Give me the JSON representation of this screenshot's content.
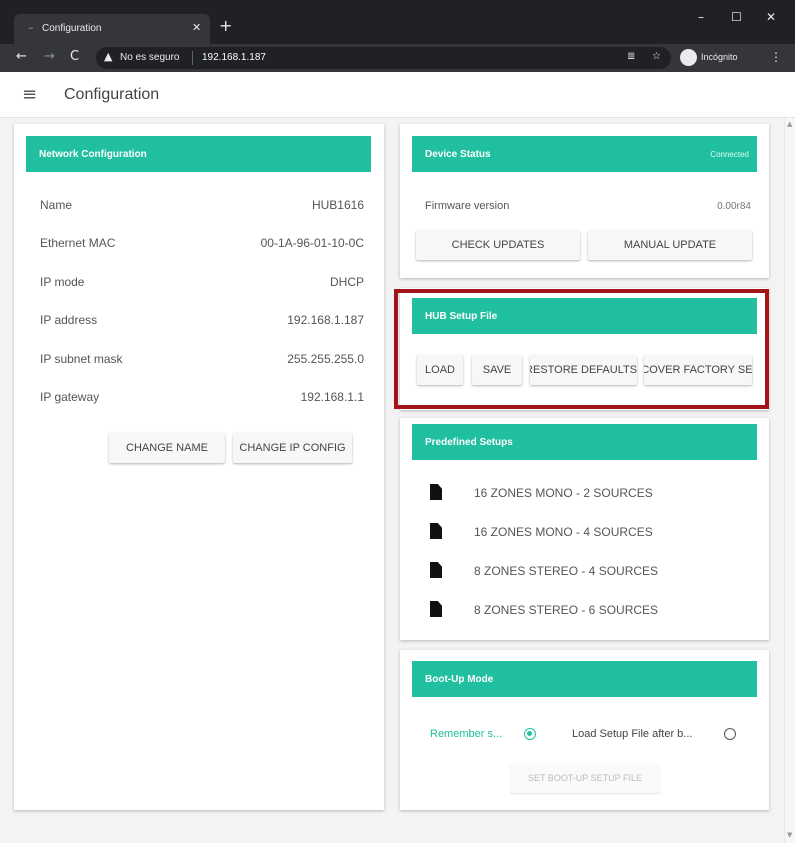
{
  "browser": {
    "tab_title": "Configuration",
    "not_secure": "No es seguro",
    "url": "192.168.1.187",
    "incognito": "Incógnito"
  },
  "app": {
    "title": "Configuration"
  },
  "network": {
    "header": "Network Configuration",
    "rows": [
      {
        "label": "Name",
        "value": "HUB1616"
      },
      {
        "label": "Ethernet MAC",
        "value": "00-1A-96-01-10-0C"
      },
      {
        "label": "IP mode",
        "value": "DHCP"
      },
      {
        "label": "IP address",
        "value": "192.168.1.187"
      },
      {
        "label": "IP subnet mask",
        "value": "255.255.255.0"
      },
      {
        "label": "IP gateway",
        "value": "192.168.1.1"
      }
    ],
    "change_name": "CHANGE NAME",
    "change_ip": "CHANGE IP CONFIG"
  },
  "device_status": {
    "header": "Device Status",
    "status": "Connected",
    "firmware_label": "Firmware version",
    "firmware_value": "0.00r84",
    "check_updates": "CHECK UPDATES",
    "manual_update": "MANUAL UPDATE"
  },
  "hub_setup": {
    "header": "HUB Setup File",
    "load": "LOAD",
    "save": "SAVE",
    "restore": "RESTORE DEFAULTS",
    "recover": "RECOVER FACTORY SETUP"
  },
  "predefined": {
    "header": "Predefined Setups",
    "items": [
      "16 ZONES MONO - 2 SOURCES",
      "16 ZONES MONO - 4 SOURCES",
      "8 ZONES STEREO - 4 SOURCES",
      "8 ZONES STEREO - 6 SOURCES"
    ]
  },
  "boot": {
    "header": "Boot-Up Mode",
    "remember": "Remember s...",
    "load_after": "Load Setup File after b...",
    "remember_selected": true,
    "set_button": "SET BOOT-UP SETUP FILE"
  },
  "colors": {
    "accent": "#1fbf9f",
    "highlight": "#a1141a"
  }
}
